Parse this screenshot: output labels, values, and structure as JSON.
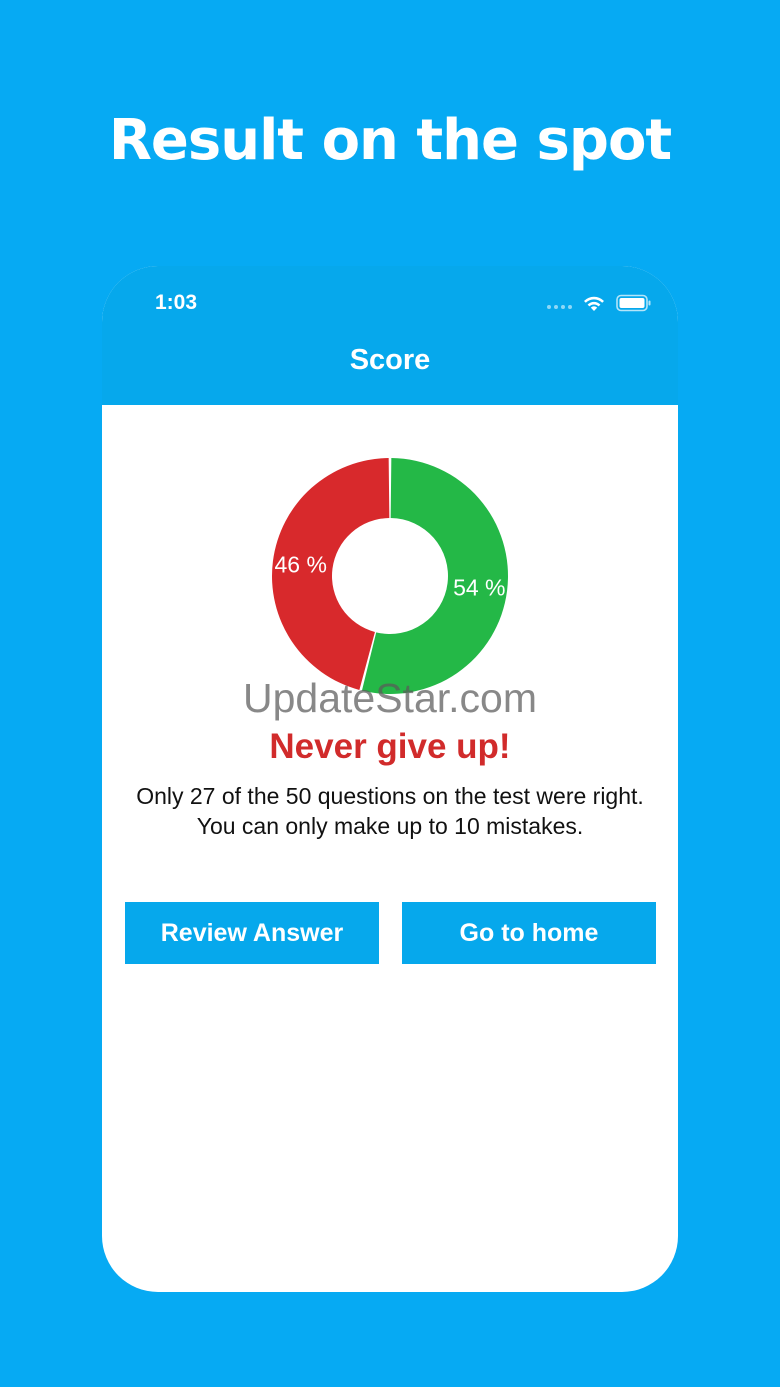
{
  "promo": {
    "headline": "Result on the spot"
  },
  "status_bar": {
    "time": "1:03",
    "icons": [
      "signal-dots-icon",
      "wifi-icon",
      "battery-icon"
    ]
  },
  "nav": {
    "title": "Score"
  },
  "chart_data": {
    "type": "pie",
    "style": "donut",
    "slices": [
      {
        "label": "54 %",
        "value": 54,
        "color": "#24b847"
      },
      {
        "label": "46 %",
        "value": 46,
        "color": "#d8292c"
      }
    ]
  },
  "watermark": "UpdateStar.com",
  "result": {
    "title": "Never give up!",
    "message": "Only 27 of the 50 questions on the test were right. You can only make up to 10 mistakes."
  },
  "buttons": {
    "review": "Review Answer",
    "home": "Go to home"
  },
  "colors": {
    "background": "#06aaf3",
    "header": "#06a8ec",
    "button": "#06a8ec",
    "accent_red": "#d12b2b",
    "correct_green": "#24b847",
    "wrong_red": "#d8292c"
  }
}
